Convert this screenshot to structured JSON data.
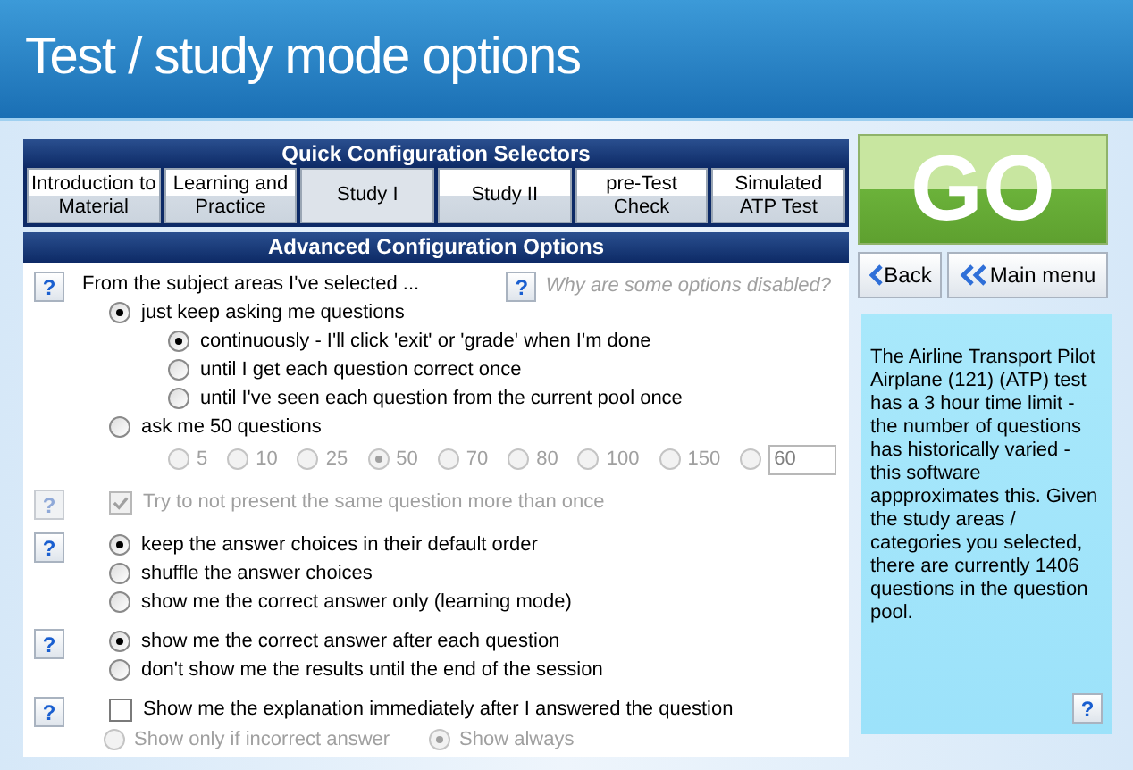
{
  "title": "Test / study mode options",
  "quick_config": {
    "heading": "Quick Configuration Selectors",
    "tabs": [
      {
        "label": "Introduction to Material",
        "selected": false
      },
      {
        "label": "Learning and Practice",
        "selected": false
      },
      {
        "label": "Study I",
        "selected": true
      },
      {
        "label": "Study II",
        "selected": false
      },
      {
        "label": "pre-Test Check",
        "selected": false
      },
      {
        "label": "Simulated ATP Test",
        "selected": false
      }
    ]
  },
  "advanced": {
    "heading": "Advanced Configuration Options",
    "disabled_help": {
      "icon": "?",
      "text": "Why are some options disabled?"
    },
    "groups": [
      {
        "help": "?",
        "help_disabled": false,
        "items": [
          {
            "kind": "label",
            "label": "From the subject areas I've selected ...",
            "children": [
              {
                "kind": "radio",
                "label": "just keep asking me questions",
                "selected": true,
                "disabled": false,
                "children": [
                  {
                    "kind": "radio",
                    "label": "continuously - I'll click 'exit' or 'grade' when I'm done",
                    "selected": true,
                    "disabled": false
                  },
                  {
                    "kind": "radio",
                    "label": "until I get each question correct once",
                    "selected": false,
                    "disabled": false
                  },
                  {
                    "kind": "radio",
                    "label": "until I've seen each question from the current pool once",
                    "selected": false,
                    "disabled": false
                  }
                ]
              },
              {
                "kind": "radio",
                "label": "ask me 50 questions",
                "selected": false,
                "disabled": false,
                "children": [
                  {
                    "kind": "counts",
                    "disabled": true,
                    "options": [
                      {
                        "label": "5",
                        "selected": false
                      },
                      {
                        "label": "10",
                        "selected": false
                      },
                      {
                        "label": "25",
                        "selected": false
                      },
                      {
                        "label": "50",
                        "selected": true
                      },
                      {
                        "label": "70",
                        "selected": false
                      },
                      {
                        "label": "80",
                        "selected": false
                      },
                      {
                        "label": "100",
                        "selected": false
                      },
                      {
                        "label": "150",
                        "selected": false
                      }
                    ],
                    "custom": {
                      "selected": false,
                      "value": "60"
                    }
                  }
                ]
              }
            ]
          }
        ]
      },
      {
        "help": "?",
        "help_disabled": true,
        "items": [
          {
            "kind": "checkbox",
            "label": "Try to not present the same question more than once",
            "checked": true,
            "disabled": true
          }
        ]
      },
      {
        "help": "?",
        "help_disabled": false,
        "items": [
          {
            "kind": "radio",
            "label": "keep the answer choices in their default order",
            "selected": true,
            "disabled": false
          },
          {
            "kind": "radio",
            "label": "shuffle the answer choices",
            "selected": false,
            "disabled": false
          },
          {
            "kind": "radio",
            "label": "show me the correct answer only (learning mode)",
            "selected": false,
            "disabled": false
          }
        ]
      },
      {
        "help": "?",
        "help_disabled": false,
        "items": [
          {
            "kind": "radio",
            "label": "show me the correct answer after each question",
            "selected": true,
            "disabled": false
          },
          {
            "kind": "radio",
            "label": "don't show me the results until the end of the session",
            "selected": false,
            "disabled": false
          }
        ]
      },
      {
        "help": "?",
        "help_disabled": false,
        "items": [
          {
            "kind": "checkbox",
            "label": "Show me the explanation immediately after I answered the question",
            "checked": false,
            "disabled": false,
            "children": [
              {
                "kind": "inline_radios",
                "disabled": true,
                "options": [
                  {
                    "label": "Show only if incorrect answer",
                    "selected": false
                  },
                  {
                    "label": "Show always",
                    "selected": true
                  }
                ]
              }
            ]
          }
        ]
      }
    ]
  },
  "go_button": "GO",
  "nav_buttons": [
    {
      "label": "Back",
      "kind": "back"
    },
    {
      "label": "Main menu",
      "kind": "main"
    }
  ],
  "info": {
    "text": "The Airline Transport Pilot Airplane (121) (ATP) test has a 3 hour time limit - the number of questions has historically varied - this software appproximates this.  Given the study areas / categories you selected, there are currently 1406 questions in the question pool.",
    "help": "?"
  }
}
